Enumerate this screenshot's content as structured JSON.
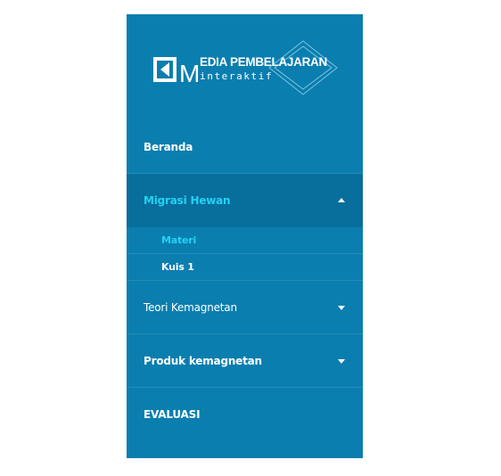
{
  "logo": {
    "title": "EDIA PEMBELAJARAN",
    "subtitle": "interaktif",
    "initial": "M"
  },
  "menu": {
    "items": [
      {
        "label": "Beranda"
      },
      {
        "label": "Migrasi Hewan"
      },
      {
        "label": "Teori Kemagnetan"
      },
      {
        "label": "Produk kemagnetan"
      },
      {
        "label": "EVALUASI"
      }
    ],
    "submenu": [
      {
        "label": "Materi"
      },
      {
        "label": "Kuis 1"
      }
    ]
  },
  "colors": {
    "sidebar_bg": "#0a7eaf",
    "active_bg": "#086e9b",
    "accent": "#22d3f5"
  }
}
